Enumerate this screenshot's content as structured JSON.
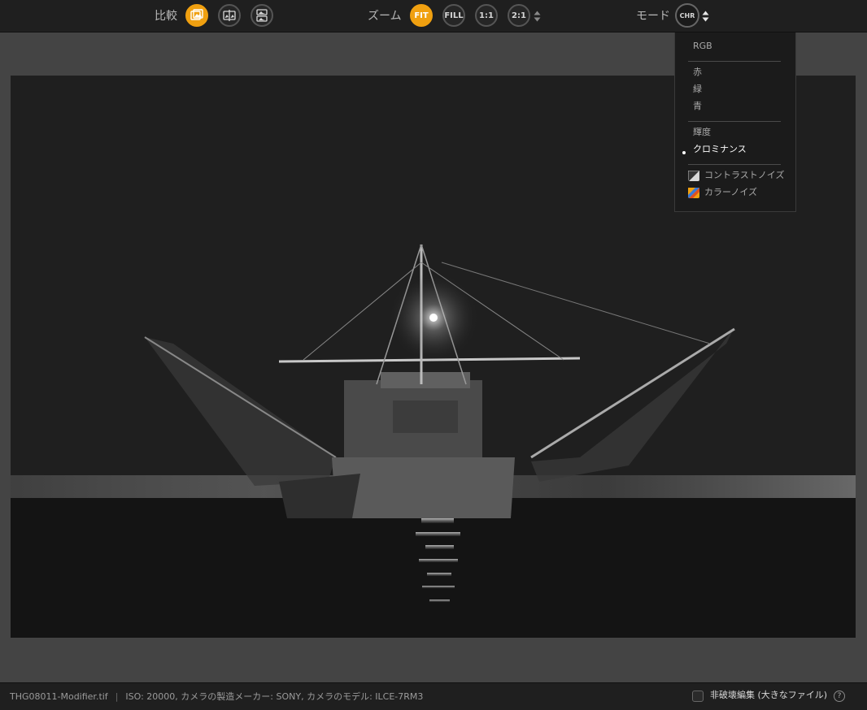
{
  "toolbar": {
    "compare_label": "比較",
    "zoom_label": "ズーム",
    "zoom_fit": "FIT",
    "zoom_fill": "FILL",
    "zoom_1_1": "1:1",
    "zoom_2_1": "2:1",
    "mode_label": "モード",
    "mode_value": "CHR",
    "accent_color": "#f0a010"
  },
  "mode_menu": {
    "items": [
      "RGB",
      "赤",
      "緑",
      "青",
      "輝度",
      "クロミナンス"
    ],
    "selected": "クロミナンス",
    "overlay_contrast": "コントラストノイズ",
    "overlay_color": "カラーノイズ"
  },
  "status": {
    "filename": "THG08011-Modifier.tif",
    "separator": "|",
    "metadata": "ISO: 20000, カメラの製造メーカー: SONY, カメラのモデル: ILCE-7RM3",
    "nondestructive_label": "非破壊編集 (大きなファイル)",
    "help": "?"
  }
}
